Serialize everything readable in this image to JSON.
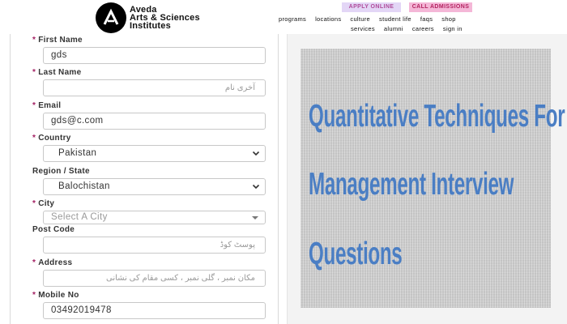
{
  "header": {
    "logo_lines": [
      "Aveda",
      "Arts & Sciences",
      "Institutes"
    ],
    "apply_label": "APPLY ONLINE",
    "call_label": "CALL ADMISSIONS",
    "nav_row1": [
      "programs",
      "locations",
      "culture",
      "student life",
      "faqs",
      "shop"
    ],
    "nav_row2": [
      "services",
      "alumni",
      "careers",
      "sign in"
    ]
  },
  "form": {
    "first_name": {
      "label": "First Name",
      "required": true,
      "value": "gds"
    },
    "last_name": {
      "label": "Last Name",
      "required": true,
      "placeholder": "آخری نام"
    },
    "email": {
      "label": "Email",
      "required": true,
      "value": "gds@c.com"
    },
    "country": {
      "label": "Country",
      "required": true,
      "value": "Pakistan"
    },
    "region": {
      "label": "Region / State",
      "required": false,
      "value": "Balochistan"
    },
    "city": {
      "label": "City",
      "required": true,
      "placeholder": "Select A City"
    },
    "post_code": {
      "label": "Post Code",
      "required": false,
      "placeholder": "پوسٹ کوڈ"
    },
    "address": {
      "label": "Address",
      "required": true,
      "placeholder": "مکان نمبر ، گلی نمبر ، کسی مقام کی نشانی"
    },
    "mobile": {
      "label": "Mobile No",
      "required": true,
      "value": "03492019478"
    }
  },
  "thumbnail": {
    "lines": [
      "Quantitative Techniques For",
      "Management Interview",
      "Questions"
    ],
    "text_color": "#4a7ec4"
  },
  "colors": {
    "required_star": "#a31f62",
    "apply_bg": "#e3d6f6",
    "call_bg": "#f4b7d7"
  }
}
